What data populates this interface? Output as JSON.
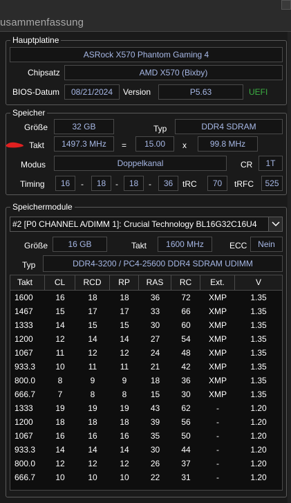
{
  "window": {
    "title": "usammenfassung"
  },
  "mainboard": {
    "group_title": "Hauptplatine",
    "name": "ASRock X570 Phantom Gaming 4",
    "chipset_label": "Chipsatz",
    "chipset": "AMD X570 (Bixby)",
    "bios_date_label": "BIOS-Datum",
    "bios_date": "08/21/2024",
    "version_label": "Version",
    "version": "P5.63",
    "uefi": "UEFI"
  },
  "memory": {
    "group_title": "Speicher",
    "size_label": "Größe",
    "size": "32 GB",
    "type_label": "Typ",
    "type": "DDR4 SDRAM",
    "clock_label": "Takt",
    "clock": "1497.3 MHz",
    "eq": "=",
    "multiplier": "15.00",
    "x": "x",
    "bclk": "99.8 MHz",
    "mode_label": "Modus",
    "mode": "Doppelkanal",
    "cr_label": "CR",
    "cr": "1T",
    "timing_label": "Timing",
    "t1": "16",
    "t2": "18",
    "t3": "18",
    "t4": "36",
    "dash": "-",
    "trc_label": "tRC",
    "trc": "70",
    "trfc_label": "tRFC",
    "trfc": "525"
  },
  "modules": {
    "group_title": "Speichermodule",
    "selected": "#2 [P0 CHANNEL A/DIMM 1]: Crucial Technology BL16G32C16U4",
    "size_label": "Größe",
    "size": "16 GB",
    "clock_label": "Takt",
    "clock": "1600 MHz",
    "ecc_label": "ECC",
    "ecc": "Nein",
    "type_label": "Typ",
    "type": "DDR4-3200 / PC4-25600 DDR4 SDRAM UDIMM"
  },
  "table": {
    "headers": [
      "Takt",
      "CL",
      "RCD",
      "RP",
      "RAS",
      "RC",
      "Ext.",
      "V"
    ],
    "rows": [
      [
        "1600",
        "16",
        "18",
        "18",
        "36",
        "72",
        "XMP",
        "1.35"
      ],
      [
        "1467",
        "15",
        "17",
        "17",
        "33",
        "66",
        "XMP",
        "1.35"
      ],
      [
        "1333",
        "14",
        "15",
        "15",
        "30",
        "60",
        "XMP",
        "1.35"
      ],
      [
        "1200",
        "12",
        "14",
        "14",
        "27",
        "54",
        "XMP",
        "1.35"
      ],
      [
        "1067",
        "11",
        "12",
        "12",
        "24",
        "48",
        "XMP",
        "1.35"
      ],
      [
        "933.3",
        "10",
        "11",
        "11",
        "21",
        "42",
        "XMP",
        "1.35"
      ],
      [
        "800.0",
        "8",
        "9",
        "9",
        "18",
        "36",
        "XMP",
        "1.35"
      ],
      [
        "666.7",
        "7",
        "8",
        "8",
        "15",
        "30",
        "XMP",
        "1.35"
      ],
      [
        "1333",
        "19",
        "19",
        "19",
        "43",
        "62",
        "-",
        "1.20"
      ],
      [
        "1200",
        "18",
        "18",
        "18",
        "39",
        "56",
        "-",
        "1.20"
      ],
      [
        "1067",
        "16",
        "16",
        "16",
        "35",
        "50",
        "-",
        "1.20"
      ],
      [
        "933.3",
        "14",
        "14",
        "14",
        "30",
        "44",
        "-",
        "1.20"
      ],
      [
        "800.0",
        "12",
        "12",
        "12",
        "26",
        "37",
        "-",
        "1.20"
      ],
      [
        "666.7",
        "10",
        "10",
        "10",
        "22",
        "31",
        "-",
        "1.20"
      ]
    ]
  },
  "colors": {
    "value_text": "#a7b8e6",
    "uefi": "#3cb043",
    "annotation": "#e02020"
  },
  "icons": {
    "dropdown": "chevron-down-icon",
    "annotation": "red-scribble-mark"
  }
}
